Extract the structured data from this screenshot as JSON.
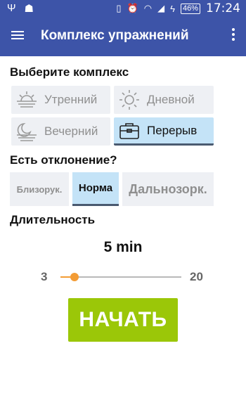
{
  "status_bar": {
    "battery": "46%",
    "time": "17:24"
  },
  "app_bar": {
    "title": "Комплекс упражнений"
  },
  "complex_section": {
    "title": "Выберите комплекс",
    "options": [
      {
        "label": "Утренний",
        "icon": "sunrise-icon",
        "selected": false
      },
      {
        "label": "Дневной",
        "icon": "sun-icon",
        "selected": false
      },
      {
        "label": "Вечерний",
        "icon": "sunset-icon",
        "selected": false
      },
      {
        "label": "Перерыв",
        "icon": "briefcase-icon",
        "selected": true
      }
    ]
  },
  "deviation_section": {
    "title": "Есть отклонение?",
    "options": [
      {
        "label": "Близорук.",
        "selected": false
      },
      {
        "label": "Норма",
        "selected": true
      },
      {
        "label": "Дальнозорк.",
        "selected": false
      }
    ]
  },
  "duration_section": {
    "title": "Длительность",
    "value_text": "5 min",
    "slider": {
      "min": 3,
      "max": 20,
      "value": 5,
      "min_label": "3",
      "max_label": "20"
    }
  },
  "start_button": {
    "label": "НАЧАТЬ"
  },
  "colors": {
    "primary": "#3d54a8",
    "accent": "#f39c35",
    "start": "#9bc708",
    "selected_tile": "#c4e3f7",
    "tile": "#eef0f4"
  }
}
